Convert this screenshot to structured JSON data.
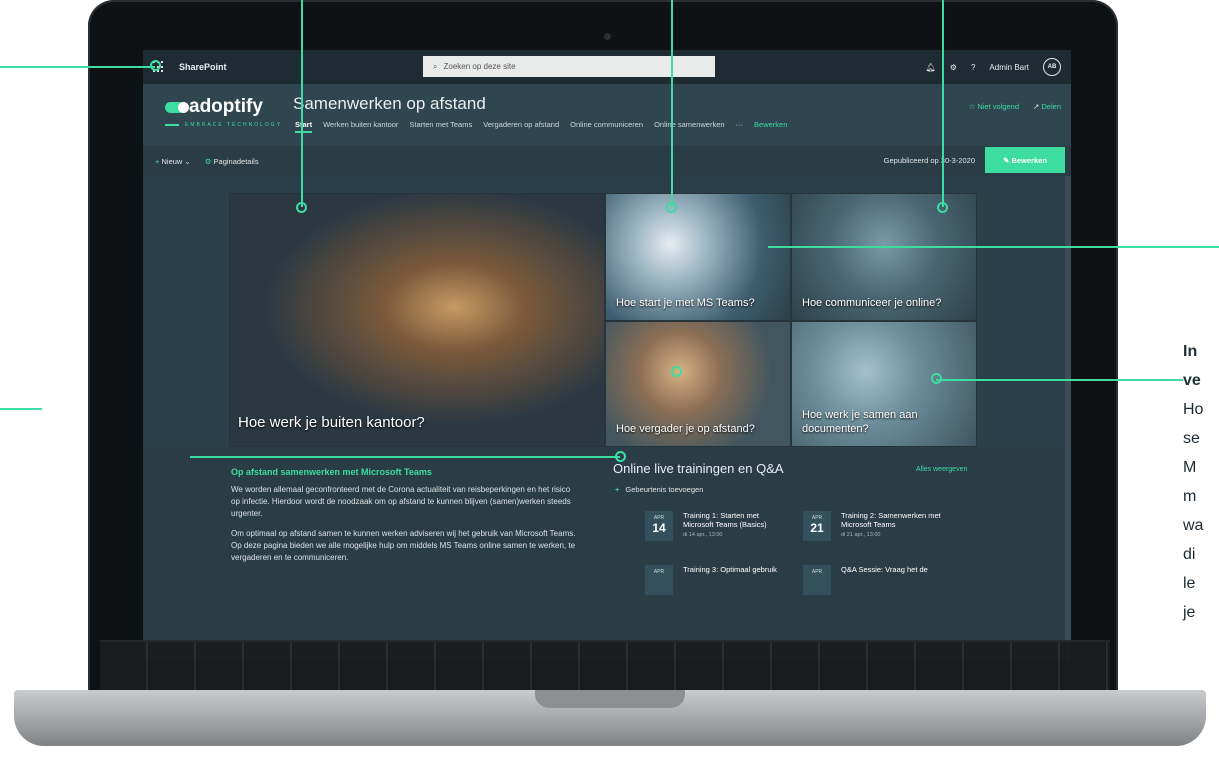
{
  "suitebar": {
    "app": "SharePoint",
    "search_placeholder": "Zoeken op deze site",
    "help": "?",
    "user": "Admin Bart",
    "initials": "AB"
  },
  "site": {
    "logo": "adoptify",
    "logo_sub": "EMBRACE TECHNOLOGY",
    "title": "Samenwerken op afstand",
    "nav": [
      "Start",
      "Werken buiten kantoor",
      "Starten met Teams",
      "Vergaderen op afstand",
      "Online communiceren",
      "Online samenwerken",
      "···",
      "Bewerken"
    ],
    "follow": "Niet volgend",
    "share": "Delen"
  },
  "cmdbar": {
    "new": "Nieuw",
    "details": "Paginadetails",
    "published": "Gepubliceerd op 30-3-2020",
    "edit": "Bewerken"
  },
  "hero": {
    "big": "Hoe werk je buiten kantoor?",
    "t1": "Hoe start je met MS Teams?",
    "t2": "Hoe communiceer je online?",
    "t3": "Hoe vergader je op afstand?",
    "t4": "Hoe werk je samen aan documenten?"
  },
  "news": {
    "title": "Op afstand samenwerken met Microsoft Teams",
    "p1": "We worden allemaal geconfronteerd met de Corona actualiteit van reisbeperkingen en het risico op infectie. Hierdoor wordt de noodzaak om op afstand te kunnen blijven (samen)werken steeds urgenter.",
    "p2": "Om optimaal op afstand samen te kunnen werken adviseren wij het gebruik van Microsoft Teams. Op deze pagina bieden we alle mogelijke hulp om middels MS Teams online samen te werken, te vergaderen en te communiceren."
  },
  "events": {
    "title": "Online live trainingen en Q&A",
    "all": "Alles weergeven",
    "add": "Gebeurtenis toevoegen",
    "items": [
      {
        "month": "APR",
        "day": "14",
        "title": "Training 1: Starten met Microsoft Teams (Basics)",
        "sub": "di 14 apr., 13:00"
      },
      {
        "month": "APR",
        "day": "21",
        "title": "Training 2: Samenwerken met Microsoft Teams",
        "sub": "di 21 apr., 13:00"
      },
      {
        "month": "APR",
        "day": "",
        "title": "Training 3: Optimaal gebruik",
        "sub": ""
      },
      {
        "month": "APR",
        "day": "",
        "title": "Q&A Sessie: Vraag het de",
        "sub": ""
      }
    ]
  },
  "side_text": {
    "l1": "In",
    "l2": "ve",
    "l3": "Ho",
    "l4": "se",
    "l5": "M",
    "l6": "m",
    "l7": "wa",
    "l8": "di",
    "l9": "le",
    "l10": "je"
  },
  "colors": {
    "accent": "#3ddca0",
    "screen_bg": "#2b3f4a",
    "suitebar": "#1f2b32"
  }
}
